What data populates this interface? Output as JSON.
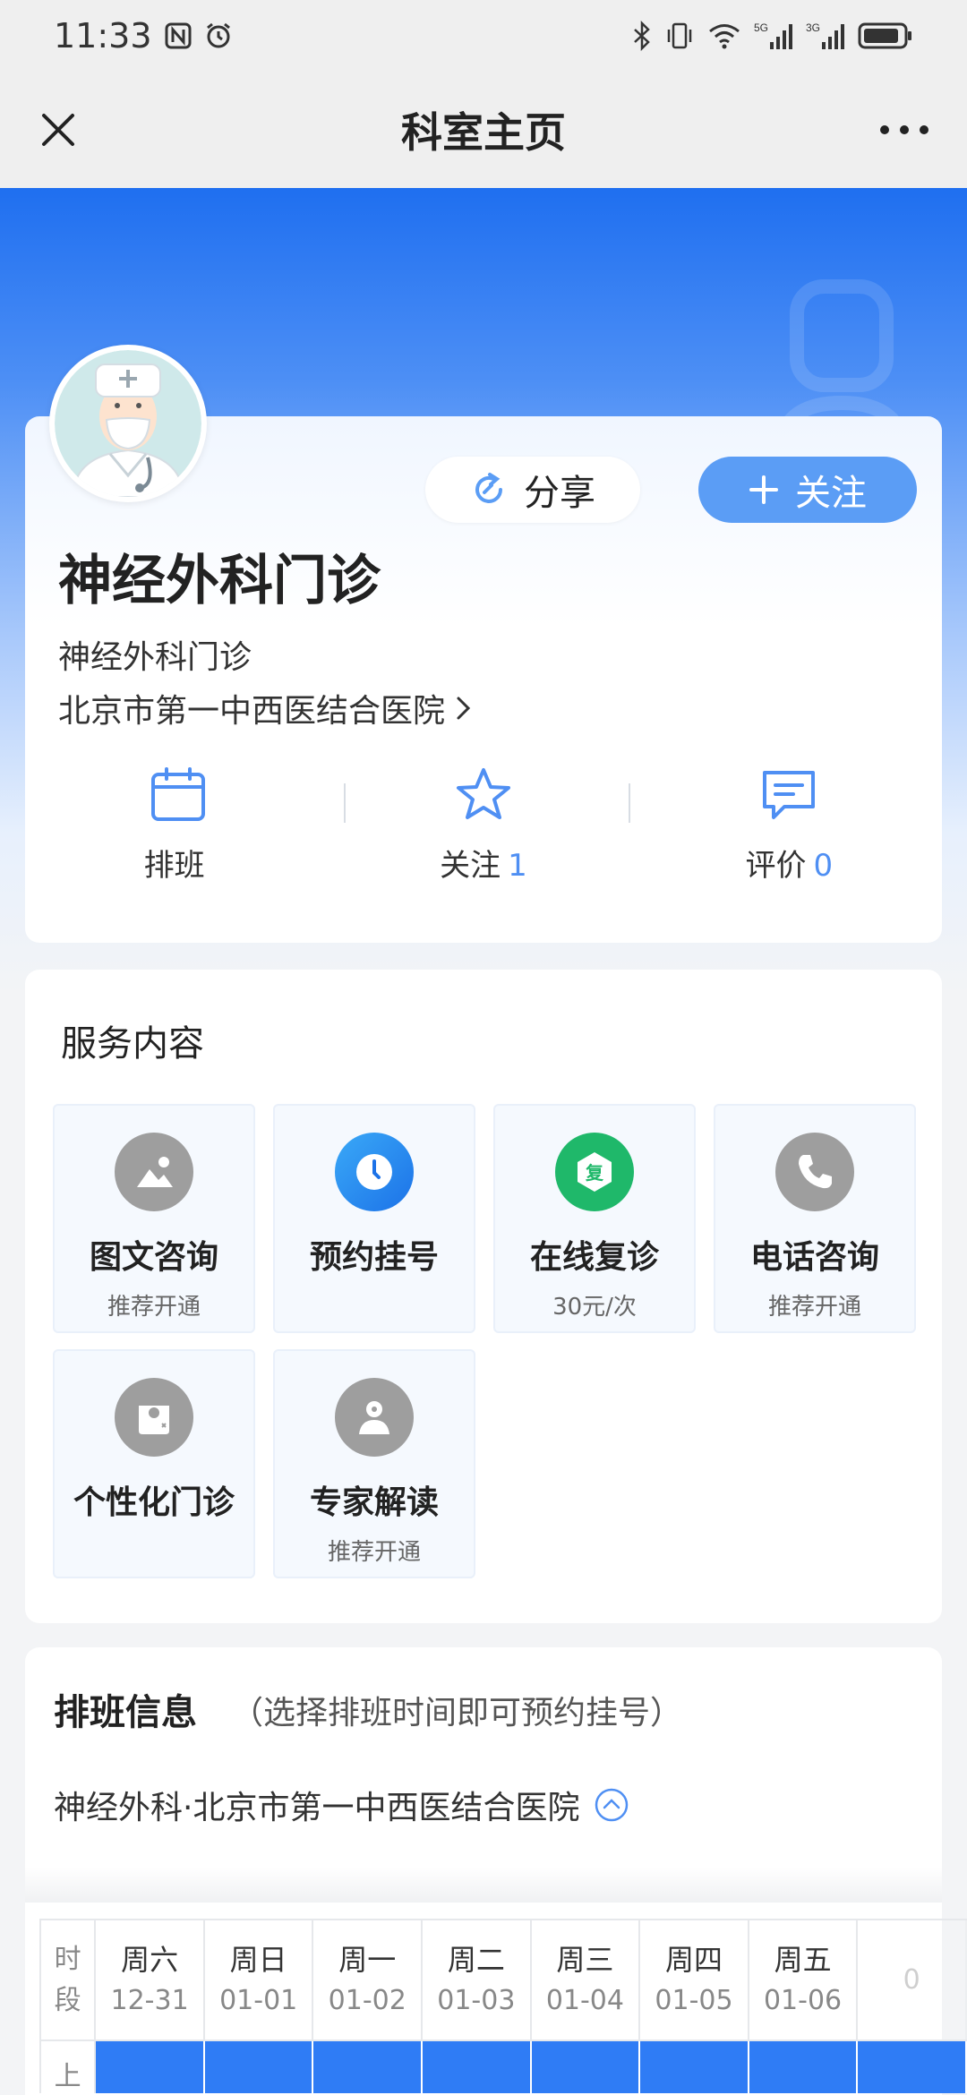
{
  "status_bar": {
    "time": "11:33",
    "net_5g": "5G",
    "net_3g": "3G"
  },
  "nav": {
    "title": "科室主页"
  },
  "profile": {
    "department": "神经外科门诊",
    "subtitle": "神经外科门诊",
    "hospital": "北京市第一中西医结合医院",
    "share_label": "分享",
    "follow_label": "关注"
  },
  "stats": [
    {
      "label": "排班",
      "count": "",
      "icon": "calendar-icon"
    },
    {
      "label": "关注",
      "count": "1",
      "icon": "star-icon"
    },
    {
      "label": "评价",
      "count": "0",
      "icon": "comment-icon"
    }
  ],
  "services": {
    "title": "服务内容",
    "items": [
      {
        "name": "图文咨询",
        "sub": "推荐开通",
        "icon": "image-text-icon",
        "color": "#9e9e9e"
      },
      {
        "name": "预约挂号",
        "sub": "",
        "icon": "clock-icon",
        "color": "#2a8ff2"
      },
      {
        "name": "在线复诊",
        "sub": "30元/次",
        "icon": "revisit-icon",
        "color": "#1fb86a"
      },
      {
        "name": "电话咨询",
        "sub": "推荐开通",
        "icon": "phone-icon",
        "color": "#9e9e9e"
      },
      {
        "name": "个性化门诊",
        "sub": "",
        "icon": "clinic-icon",
        "color": "#9e9e9e"
      },
      {
        "name": "专家解读",
        "sub": "推荐开通",
        "icon": "expert-icon",
        "color": "#9e9e9e"
      }
    ],
    "revisit_glyph": "复"
  },
  "schedule": {
    "title": "排班信息",
    "hint": "（选择排班时间即可预约挂号）",
    "filter": "神经外科·北京市第一中西医结合医院",
    "time_col_label": [
      "时",
      "段"
    ],
    "row_label": "上",
    "days": [
      {
        "name": "周六",
        "date": "12-31"
      },
      {
        "name": "周日",
        "date": "01-01"
      },
      {
        "name": "周一",
        "date": "01-02"
      },
      {
        "name": "周二",
        "date": "01-03"
      },
      {
        "name": "周三",
        "date": "01-04"
      },
      {
        "name": "周四",
        "date": "01-05"
      },
      {
        "name": "周五",
        "date": "01-06"
      },
      {
        "name": "",
        "date": "0"
      }
    ]
  },
  "colors": {
    "accent": "#5b9df5",
    "primary_blue": "#2f7cf5",
    "count_blue": "#4f8ff3"
  }
}
